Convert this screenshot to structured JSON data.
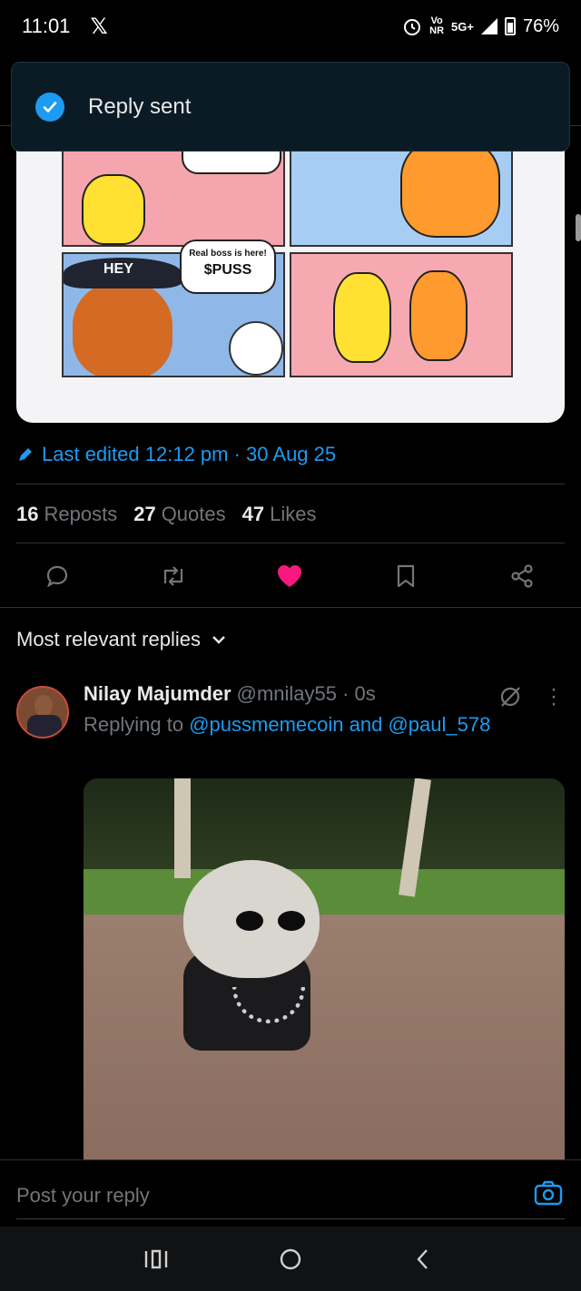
{
  "status_bar": {
    "time": "11:01",
    "app_icon": "x-logo",
    "network_top": "Vo",
    "network_bottom": "NR",
    "network_type": "5G+",
    "battery": "76%"
  },
  "toast": {
    "text": "Reply sent",
    "icon": "check-circle-icon",
    "accent": "#1d9bf0"
  },
  "media": {
    "bubble_text_1": "Real boss is here!",
    "bubble_text_2": "$PUSS",
    "hey_text": "HEY"
  },
  "edited": {
    "text": "Last edited 12:12 pm · 30 Aug 25"
  },
  "stats": {
    "reposts_count": "16",
    "reposts_label": "Reposts",
    "quotes_count": "27",
    "quotes_label": "Quotes",
    "likes_count": "47",
    "likes_label": "Likes"
  },
  "actions": {
    "icons": [
      "comment-icon",
      "repost-icon",
      "heart-icon",
      "bookmark-icon",
      "share-icon"
    ],
    "liked_color": "#f91880"
  },
  "replies": {
    "sort_label": "Most relevant replies",
    "items": [
      {
        "name": "Nilay Majumder",
        "meta": "@mnilay55 · 0s",
        "replying_prefix": "Replying to",
        "mention_1": "@pussmemecoin",
        "and": "and",
        "mention_2": "@paul_578"
      }
    ]
  },
  "composer": {
    "placeholder": "Post your reply"
  },
  "colors": {
    "background": "#000000",
    "text": "#e7e9ea",
    "muted": "#71767b",
    "link": "#1d9bf0"
  }
}
